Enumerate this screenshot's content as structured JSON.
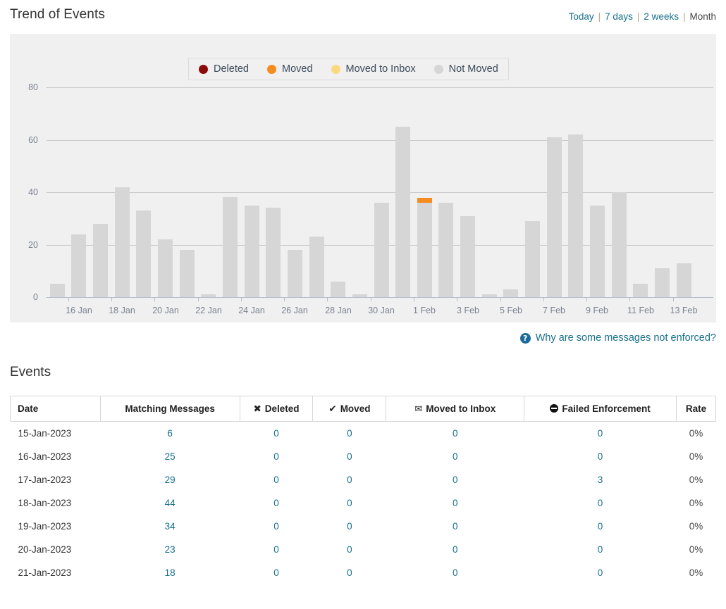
{
  "header": {
    "title": "Trend of Events",
    "ranges": [
      {
        "label": "Today",
        "active": false
      },
      {
        "label": "7 days",
        "active": false
      },
      {
        "label": "2 weeks",
        "active": false
      },
      {
        "label": "Month",
        "active": true
      }
    ],
    "separator": "|"
  },
  "chart_data": {
    "type": "bar",
    "title": "Trend of Events",
    "stacked": true,
    "xlabel": "",
    "ylabel": "",
    "ylim": [
      0,
      80
    ],
    "yticks": [
      0,
      20,
      40,
      60,
      80
    ],
    "grid": true,
    "legend_position": "top-center",
    "background": "#f0f0f0",
    "bar_color": "#d6d6d6",
    "categories": [
      "15 Jan",
      "16 Jan",
      "17 Jan",
      "18 Jan",
      "19 Jan",
      "20 Jan",
      "21 Jan",
      "22 Jan",
      "23 Jan",
      "24 Jan",
      "25 Jan",
      "26 Jan",
      "27 Jan",
      "28 Jan",
      "29 Jan",
      "30 Jan",
      "31 Jan",
      "1 Feb",
      "2 Feb",
      "3 Feb",
      "4 Feb",
      "5 Feb",
      "6 Feb",
      "7 Feb",
      "8 Feb",
      "9 Feb",
      "10 Feb",
      "11 Feb",
      "12 Feb",
      "13 Feb",
      "14 Feb"
    ],
    "tick_labels": [
      "16 Jan",
      "18 Jan",
      "20 Jan",
      "22 Jan",
      "24 Jan",
      "26 Jan",
      "28 Jan",
      "30 Jan",
      "1 Feb",
      "3 Feb",
      "5 Feb",
      "7 Feb",
      "9 Feb",
      "11 Feb",
      "13 Feb"
    ],
    "series": [
      {
        "name": "Deleted",
        "color": "#8b0b0b",
        "values": [
          0,
          0,
          0,
          0,
          0,
          0,
          0,
          0,
          0,
          0,
          0,
          0,
          0,
          0,
          0,
          0,
          0,
          0,
          0,
          0,
          0,
          0,
          0,
          0,
          0,
          0,
          0,
          0,
          0,
          0,
          0
        ]
      },
      {
        "name": "Moved",
        "color": "#f68b1f",
        "values": [
          0,
          0,
          0,
          0,
          0,
          0,
          0,
          0,
          0,
          0,
          0,
          0,
          0,
          0,
          0,
          0,
          0,
          2,
          0,
          0,
          0,
          0,
          0,
          0,
          0,
          0,
          0,
          0,
          0,
          0,
          0
        ]
      },
      {
        "name": "Moved to Inbox",
        "color": "#fcd87f",
        "values": [
          0,
          0,
          0,
          0,
          0,
          0,
          0,
          0,
          0,
          0,
          0,
          0,
          0,
          0,
          0,
          0,
          0,
          0,
          0,
          0,
          0,
          0,
          0,
          0,
          0,
          0,
          0,
          0,
          0,
          0,
          0
        ]
      },
      {
        "name": "Not Moved",
        "color": "#d6d6d6",
        "values": [
          5,
          24,
          28,
          42,
          33,
          22,
          18,
          1,
          38,
          35,
          34,
          18,
          23,
          6,
          1,
          36,
          65,
          36,
          36,
          31,
          1,
          3,
          29,
          61,
          62,
          35,
          40,
          5,
          11,
          13,
          0
        ]
      }
    ],
    "totals": [
      5,
      24,
      28,
      42,
      33,
      22,
      18,
      1,
      38,
      35,
      34,
      18,
      23,
      6,
      1,
      36,
      65,
      38,
      36,
      31,
      1,
      3,
      29,
      61,
      62,
      35,
      40,
      5,
      11,
      13,
      0
    ]
  },
  "legend": {
    "items": [
      {
        "label": "Deleted",
        "color": "#8b0b0b"
      },
      {
        "label": "Moved",
        "color": "#f68b1f"
      },
      {
        "label": "Moved to Inbox",
        "color": "#fcd87f"
      },
      {
        "label": "Not Moved",
        "color": "#d6d6d6"
      }
    ]
  },
  "chart_footer": {
    "help_label": "Why are some messages not enforced?",
    "help_icon": "question-circle-icon",
    "help_glyph": "?"
  },
  "events": {
    "title": "Events",
    "columns": [
      {
        "key": "date",
        "label": "Date",
        "icon": null
      },
      {
        "key": "matching",
        "label": "Matching Messages",
        "icon": null
      },
      {
        "key": "deleted",
        "label": "Deleted",
        "icon": "cross-icon",
        "glyph": "✖"
      },
      {
        "key": "moved",
        "label": "Moved",
        "icon": "check-icon",
        "glyph": "✔"
      },
      {
        "key": "inbox",
        "label": "Moved to Inbox",
        "icon": "envelope-icon",
        "glyph": "✉"
      },
      {
        "key": "failed",
        "label": "Failed Enforcement",
        "icon": "minus-circle-icon",
        "glyph": ""
      },
      {
        "key": "rate",
        "label": "Rate",
        "icon": null
      }
    ],
    "rows": [
      {
        "date": "15-Jan-2023",
        "matching": "6",
        "deleted": "0",
        "moved": "0",
        "inbox": "0",
        "failed": "0",
        "rate": "0%"
      },
      {
        "date": "16-Jan-2023",
        "matching": "25",
        "deleted": "0",
        "moved": "0",
        "inbox": "0",
        "failed": "0",
        "rate": "0%"
      },
      {
        "date": "17-Jan-2023",
        "matching": "29",
        "deleted": "0",
        "moved": "0",
        "inbox": "0",
        "failed": "3",
        "rate": "0%"
      },
      {
        "date": "18-Jan-2023",
        "matching": "44",
        "deleted": "0",
        "moved": "0",
        "inbox": "0",
        "failed": "0",
        "rate": "0%"
      },
      {
        "date": "19-Jan-2023",
        "matching": "34",
        "deleted": "0",
        "moved": "0",
        "inbox": "0",
        "failed": "0",
        "rate": "0%"
      },
      {
        "date": "20-Jan-2023",
        "matching": "23",
        "deleted": "0",
        "moved": "0",
        "inbox": "0",
        "failed": "0",
        "rate": "0%"
      },
      {
        "date": "21-Jan-2023",
        "matching": "18",
        "deleted": "0",
        "moved": "0",
        "inbox": "0",
        "failed": "0",
        "rate": "0%"
      }
    ]
  }
}
